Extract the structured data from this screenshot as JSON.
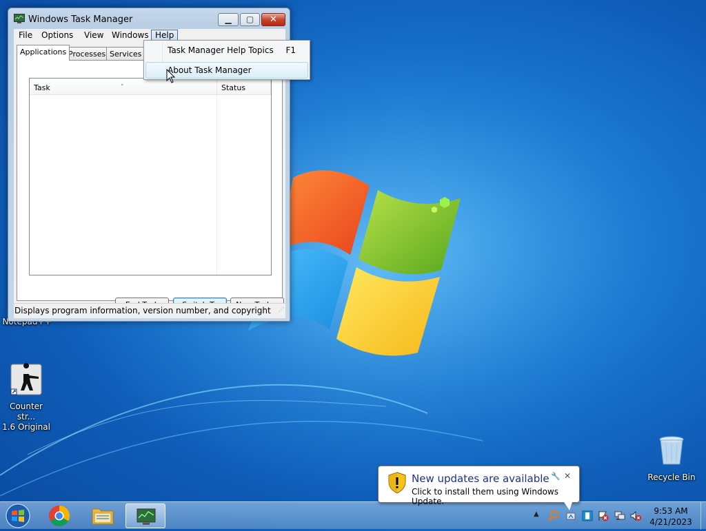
{
  "window": {
    "title": "Windows Task Manager",
    "controls": {
      "minimize": "▁",
      "maximize": "▢",
      "close": "✕"
    }
  },
  "menubar": [
    {
      "label": "File"
    },
    {
      "label": "Options"
    },
    {
      "label": "View"
    },
    {
      "label": "Windows"
    },
    {
      "label": "Help"
    }
  ],
  "tabs": [
    {
      "label": "Applications"
    },
    {
      "label": "Processes"
    },
    {
      "label": "Services"
    }
  ],
  "task_list": {
    "columns": [
      {
        "label": "Task"
      },
      {
        "label": "Status"
      }
    ],
    "rows": []
  },
  "buttons": {
    "end_task": "End Task",
    "switch_to": "Switch To",
    "new_task": "New Task..."
  },
  "status_bar": "Displays program information, version number, and copyright",
  "help_menu": {
    "items": [
      {
        "label": "Task Manager Help Topics",
        "shortcut": "F1"
      },
      {
        "label": "About Task Manager",
        "shortcut": ""
      }
    ]
  },
  "desktop": {
    "icons": [
      {
        "label": "Notepad++"
      },
      {
        "label": "Counter str...",
        "label2": "1.6 Original"
      },
      {
        "label": "Recycle Bin"
      }
    ]
  },
  "notification": {
    "title": "New updates are available",
    "message": "Click to install them using Windows Update."
  },
  "taskbar": {
    "time": "9:53 AM",
    "date": "4/21/2023"
  },
  "colors": {
    "accent": "#3c6fa8",
    "balloon_title": "#1e3287",
    "close_button": "#c7452d"
  }
}
